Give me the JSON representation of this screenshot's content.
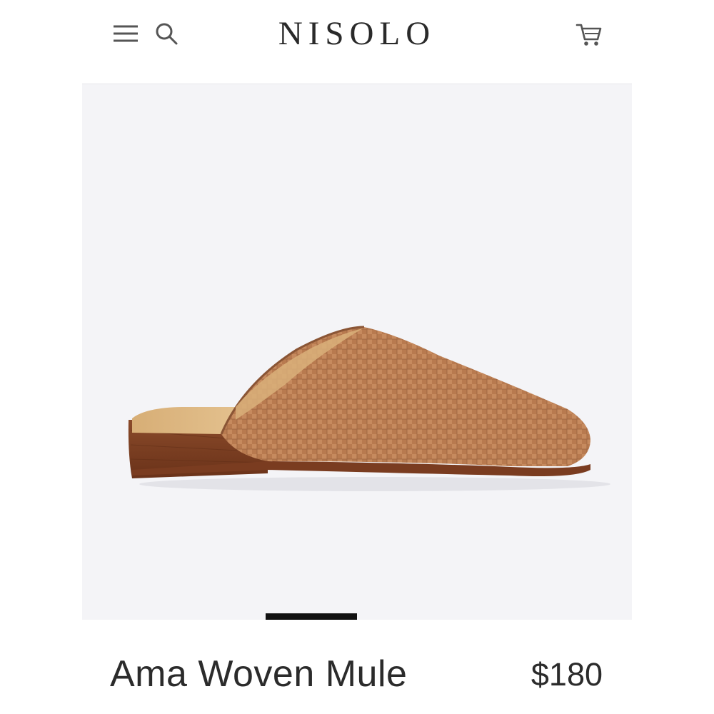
{
  "header": {
    "brand": "NISOLO",
    "menu_icon": "hamburger-menu-icon",
    "search_icon": "search-icon",
    "cart_icon": "shopping-cart-icon"
  },
  "product": {
    "name": "Ama Woven Mule",
    "price": "$180",
    "image_description_icon": "woven-leather-mule-shoe",
    "colors": {
      "leather": "#b87a4f",
      "heel": "#7a3f22",
      "insole": "#dcb57e",
      "background": "#f4f4f7"
    }
  },
  "carousel": {
    "active_index": 1,
    "total_visible": 1
  }
}
